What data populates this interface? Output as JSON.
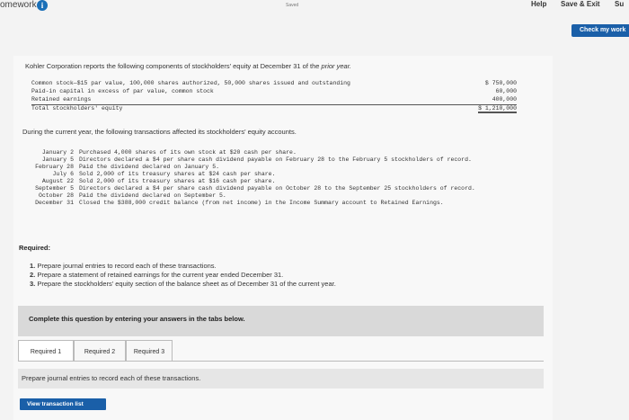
{
  "header": {
    "brand": "omework",
    "saved": "Saved",
    "help": "Help",
    "save_exit": "Save & Exit",
    "submit": "Su"
  },
  "check_button": "Check my work",
  "intro": {
    "text": "Kohler Corporation reports the following components of stockholders' equity at December 31 of the ",
    "italic": "prior year.",
    "rows": [
      {
        "label": "Common stock—$15 par value, 100,000 shares authorized, 50,000 shares issued and outstanding",
        "amount": "$ 750,000"
      },
      {
        "label": "Paid-in capital in excess of par value, common stock",
        "amount": "60,000"
      },
      {
        "label": "Retained earnings",
        "amount": "400,000"
      },
      {
        "label": "Total stockholders' equity",
        "amount": "$ 1,210,000"
      }
    ]
  },
  "during_text": "During the current year, the following transactions affected its stockholders' equity accounts.",
  "transactions": [
    {
      "date": "January 2",
      "desc": "Purchased 4,000 shares of its own stock at $20 cash per share."
    },
    {
      "date": "January 5",
      "desc": "Directors declared a $4 per share cash dividend payable on February 28 to the February 5 stockholders of record."
    },
    {
      "date": "February 28",
      "desc": "Paid the dividend declared on January 5."
    },
    {
      "date": "July 6",
      "desc": "Sold 2,000 of its treasury shares at $24 cash per share."
    },
    {
      "date": "August 22",
      "desc": "Sold 2,000 of its treasury shares at $16 cash per share."
    },
    {
      "date": "September 5",
      "desc": "Directors declared a $4 per share cash dividend payable on October 28 to the September 25 stockholders of record."
    },
    {
      "date": "October 28",
      "desc": "Paid the dividend declared on September 5."
    },
    {
      "date": "December 31",
      "desc": "Closed the $388,000 credit balance (from net income) in the Income Summary account to Retained Earnings."
    }
  ],
  "required": {
    "heading": "Required:",
    "items": [
      {
        "num": "1.",
        "text": "Prepare journal entries to record each of these transactions."
      },
      {
        "num": "2.",
        "text": "Prepare a statement of retained earnings for the current year ended December 31."
      },
      {
        "num": "3.",
        "text": "Prepare the stockholders' equity section of the balance sheet as of December 31 of the current year."
      }
    ]
  },
  "complete_text": "Complete this question by entering your answers in the tabs below.",
  "tabs": [
    "Required 1",
    "Required 2",
    "Required 3"
  ],
  "prepare_text": "Prepare journal entries to record each of these transactions.",
  "view_button": "View transaction list"
}
